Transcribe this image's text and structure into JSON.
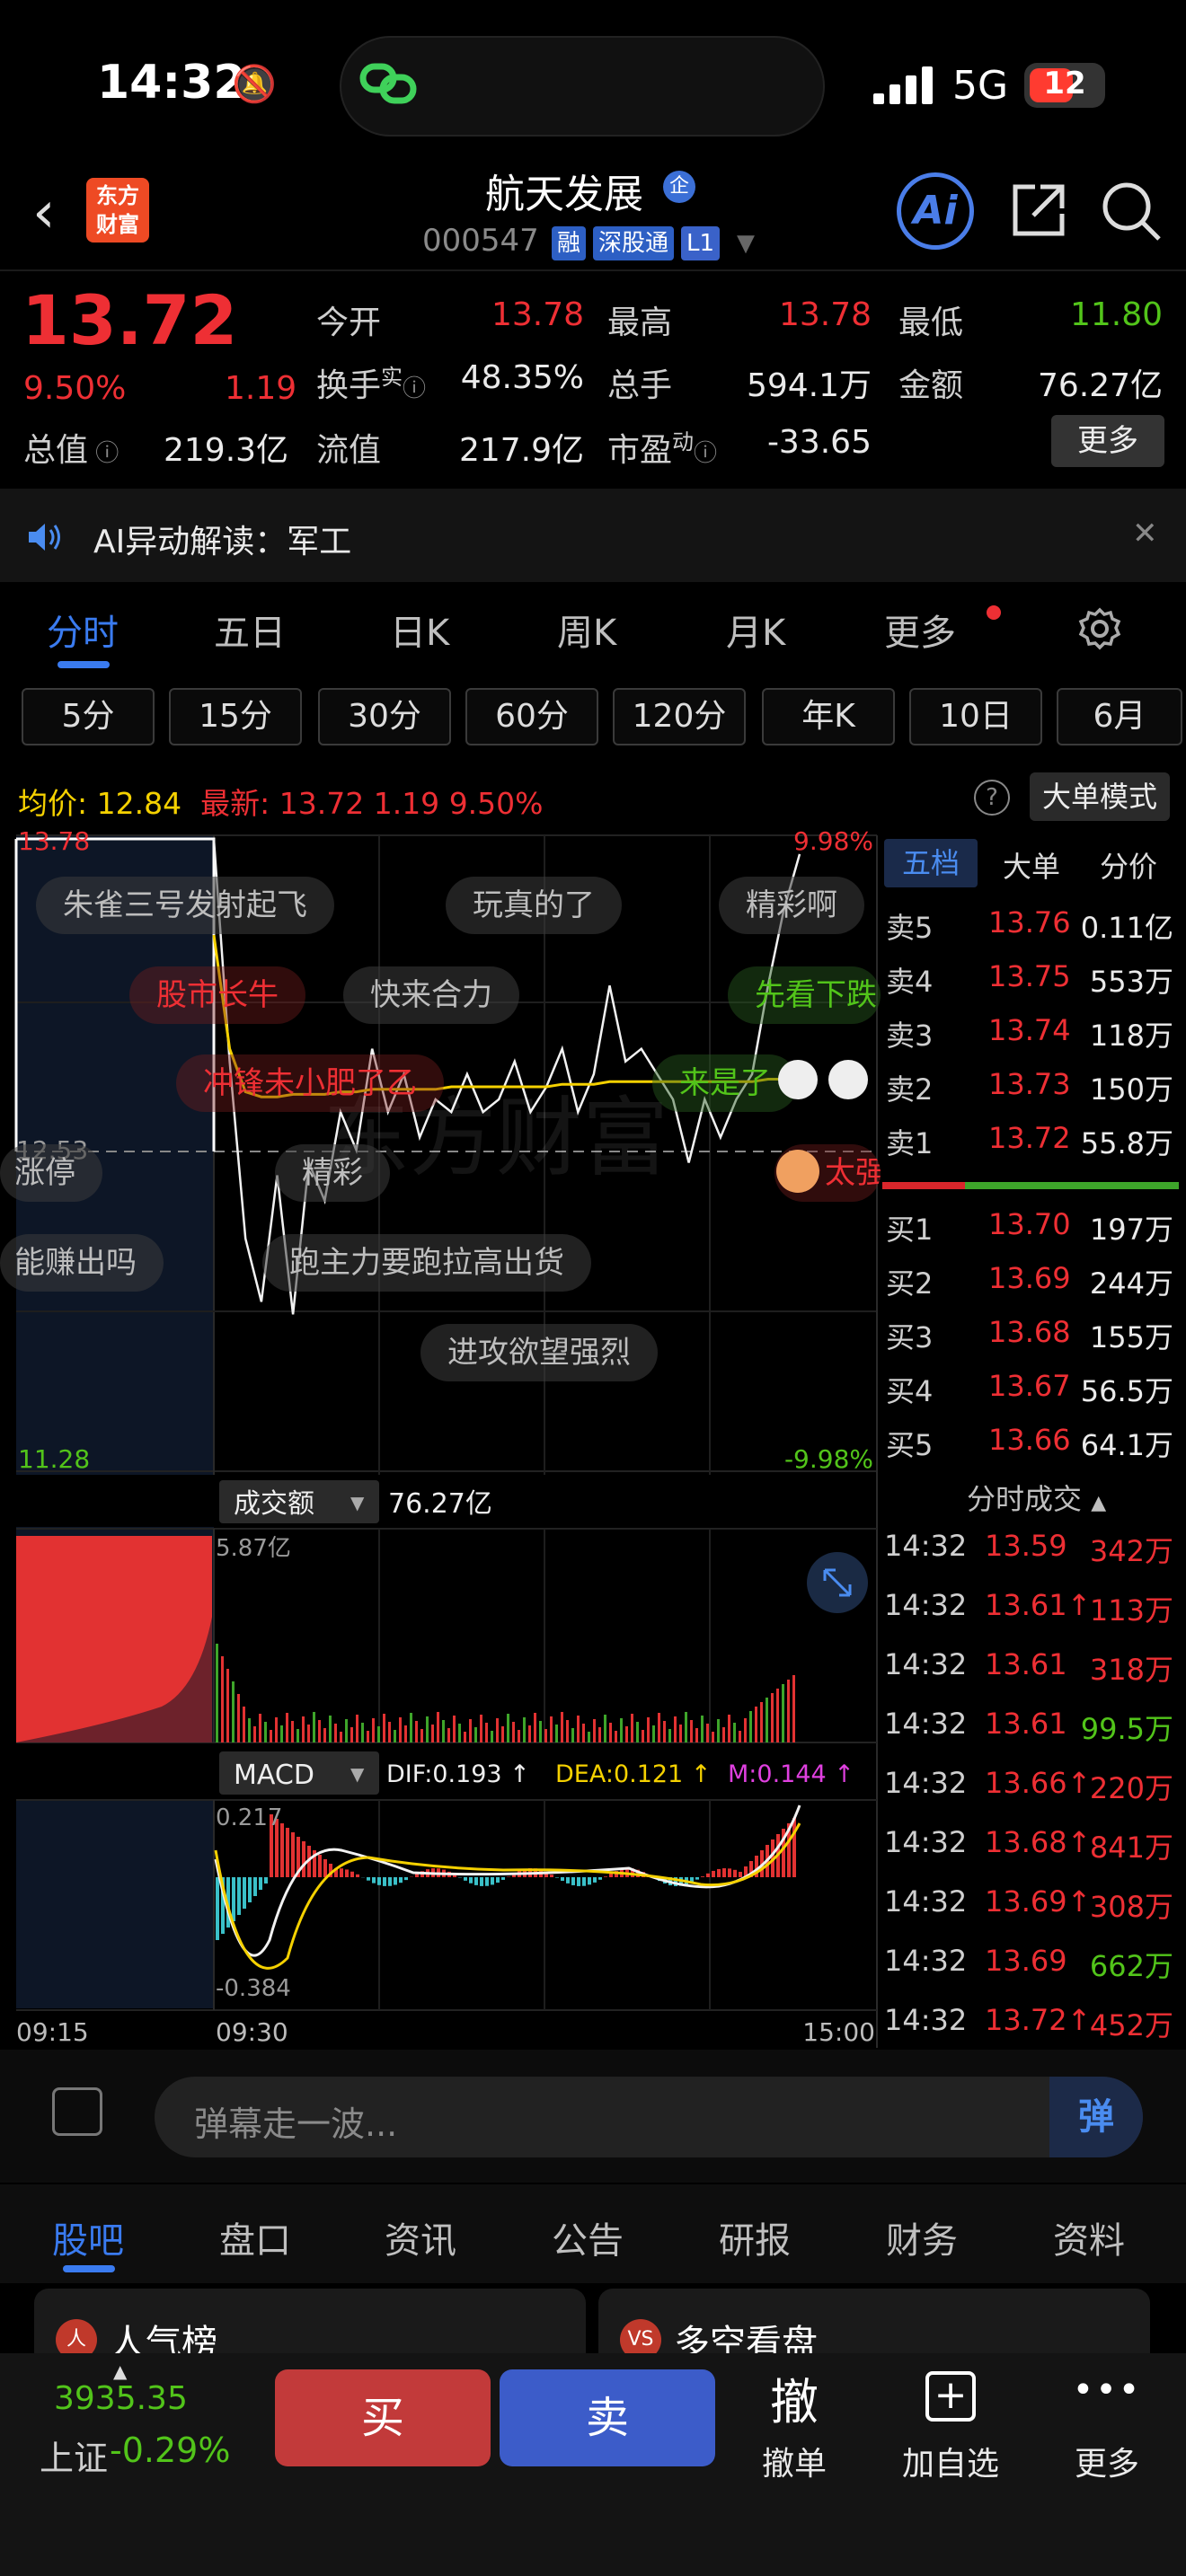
{
  "status": {
    "time": "14:32",
    "network": "5G",
    "battery": "12"
  },
  "header": {
    "logo": "东方财富",
    "title": "航天发展",
    "title_badge": "企",
    "code": "000547",
    "tags": [
      "融",
      "深股通",
      "L1"
    ],
    "ai_label": "Ai"
  },
  "quote": {
    "price": "13.72",
    "pct": "9.50%",
    "change": "1.19",
    "mcap_label": "总值",
    "mcap": "219.3亿",
    "fields": [
      {
        "label": "今开",
        "value": "13.78",
        "color": "red"
      },
      {
        "label": "最高",
        "value": "13.78",
        "color": "red"
      },
      {
        "label": "最低",
        "value": "11.80",
        "color": "green"
      },
      {
        "label": "换手",
        "value": "48.35%",
        "color": "white"
      },
      {
        "label": "总手",
        "value": "594.1万",
        "color": "white"
      },
      {
        "label": "金额",
        "value": "76.27亿",
        "color": "white"
      },
      {
        "label": "流值",
        "value": "217.9亿",
        "color": "white"
      },
      {
        "label": "市盈",
        "value": "-33.65",
        "color": "white"
      }
    ],
    "turnover_sup": "实",
    "pe_sup": "动",
    "more_button": "更多"
  },
  "ai_bar": {
    "text": "AI异动解读：军工"
  },
  "tabs": [
    "分时",
    "五日",
    "日K",
    "周K",
    "月K",
    "更多"
  ],
  "periods": [
    "5分",
    "15分",
    "30分",
    "60分",
    "120分",
    "年K",
    "10日",
    "6月"
  ],
  "info": {
    "avg_label": "均价:",
    "avg": "12.84",
    "latest_label": "最新:",
    "latest": "13.72",
    "latest_chg": "1.19",
    "latest_pct": "9.50%",
    "help": "?",
    "big_order": "大单模式"
  },
  "chart_data": {
    "type": "line",
    "title": "分时",
    "y_axis_labels": {
      "top": "13.78",
      "mid": "12.53",
      "bottom": "11.28",
      "top_pct": "9.98%",
      "bottom_pct": "-9.98%"
    },
    "x_axis_labels": [
      "09:15",
      "09:30",
      "15:00"
    ],
    "ylim": [
      11.28,
      13.78
    ],
    "preclose": 12.53,
    "price_series": [
      13.78,
      12.9,
      12.2,
      11.95,
      12.45,
      11.9,
      12.5,
      12.35,
      12.7,
      12.55,
      12.95,
      12.7,
      12.85,
      12.6,
      12.75,
      12.7,
      12.85,
      12.7,
      12.75,
      12.9,
      12.7,
      12.8,
      12.95,
      12.7,
      12.85,
      13.2,
      12.9,
      12.95,
      12.85,
      12.75,
      12.5,
      12.75,
      12.6,
      12.75,
      12.85,
      13.2,
      13.5,
      13.72
    ],
    "avg_series": [
      13.4,
      12.95,
      12.78,
      12.76,
      12.76,
      12.77,
      12.77,
      12.77,
      12.78,
      12.78,
      12.79,
      12.79,
      12.79,
      12.79,
      12.79,
      12.8,
      12.8,
      12.8,
      12.8,
      12.8,
      12.8,
      12.8,
      12.81,
      12.81,
      12.81,
      12.82,
      12.82,
      12.82,
      12.82,
      12.82,
      12.82,
      12.82,
      12.82,
      12.82,
      12.82,
      12.83,
      12.83,
      12.84
    ],
    "volume_label": "成交额",
    "volume_total": "76.27亿",
    "volume_max_label": "5.87亿",
    "macd": {
      "label": "MACD",
      "dif": "DIF:0.193 ↑",
      "dea": "DEA:0.121 ↑",
      "m": "M:0.144 ↑",
      "top": "0.217",
      "bottom": "-0.384"
    }
  },
  "danmu": [
    "朱雀三号发射起飞",
    "玩真的了",
    "精彩啊",
    "股市长牛",
    "快来合力",
    "先看下跌",
    "冲锋未小肥了乙",
    "来是了",
    "涨停",
    "精彩",
    "太强",
    "能赚出吗",
    "跑主力要跑拉高出货",
    "进攻欲望强烈"
  ],
  "orderbook": {
    "tabs": [
      "五档",
      "大单",
      "分价"
    ],
    "asks": [
      {
        "label": "卖5",
        "price": "13.76",
        "vol": "0.11亿"
      },
      {
        "label": "卖4",
        "price": "13.75",
        "vol": "553万"
      },
      {
        "label": "卖3",
        "price": "13.74",
        "vol": "118万"
      },
      {
        "label": "卖2",
        "price": "13.73",
        "vol": "150万"
      },
      {
        "label": "卖1",
        "price": "13.72",
        "vol": "55.8万"
      }
    ],
    "bids": [
      {
        "label": "买1",
        "price": "13.70",
        "vol": "197万"
      },
      {
        "label": "买2",
        "price": "13.69",
        "vol": "244万"
      },
      {
        "label": "买3",
        "price": "13.68",
        "vol": "155万"
      },
      {
        "label": "买4",
        "price": "13.67",
        "vol": "56.5万"
      },
      {
        "label": "买5",
        "price": "13.66",
        "vol": "64.1万"
      }
    ]
  },
  "ticks": {
    "title": "分时成交",
    "rows": [
      {
        "time": "14:32",
        "price": "13.59",
        "vol": "342万",
        "vcolor": "red"
      },
      {
        "time": "14:32",
        "price": "13.61↑",
        "vol": "113万",
        "vcolor": "red"
      },
      {
        "time": "14:32",
        "price": "13.61",
        "vol": "318万",
        "vcolor": "red"
      },
      {
        "time": "14:32",
        "price": "13.61",
        "vol": "99.5万",
        "vcolor": "green"
      },
      {
        "time": "14:32",
        "price": "13.66↑",
        "vol": "220万",
        "vcolor": "red"
      },
      {
        "time": "14:32",
        "price": "13.68↑",
        "vol": "841万",
        "vcolor": "red"
      },
      {
        "time": "14:32",
        "price": "13.69↑",
        "vol": "308万",
        "vcolor": "red"
      },
      {
        "time": "14:32",
        "price": "13.69",
        "vol": "662万",
        "vcolor": "green"
      },
      {
        "time": "14:32",
        "price": "13.72↑",
        "vol": "452万",
        "vcolor": "red"
      }
    ]
  },
  "comment": {
    "placeholder": "弹幕走一波...",
    "send": "弹"
  },
  "bottom_tabs": [
    "股吧",
    "盘口",
    "资讯",
    "公告",
    "研报",
    "财务",
    "资料"
  ],
  "cards": [
    {
      "label": "人气榜",
      "icon": "人"
    },
    {
      "label": "多空看盘",
      "icon": "VS"
    }
  ],
  "action_bar": {
    "index_value": "3935.35",
    "index_name": "上证",
    "index_pct": "-0.29%",
    "buy": "买",
    "sell": "卖",
    "cancel_icon": "撤",
    "cancel": "撤单",
    "add": "加自选",
    "more": "更多"
  }
}
